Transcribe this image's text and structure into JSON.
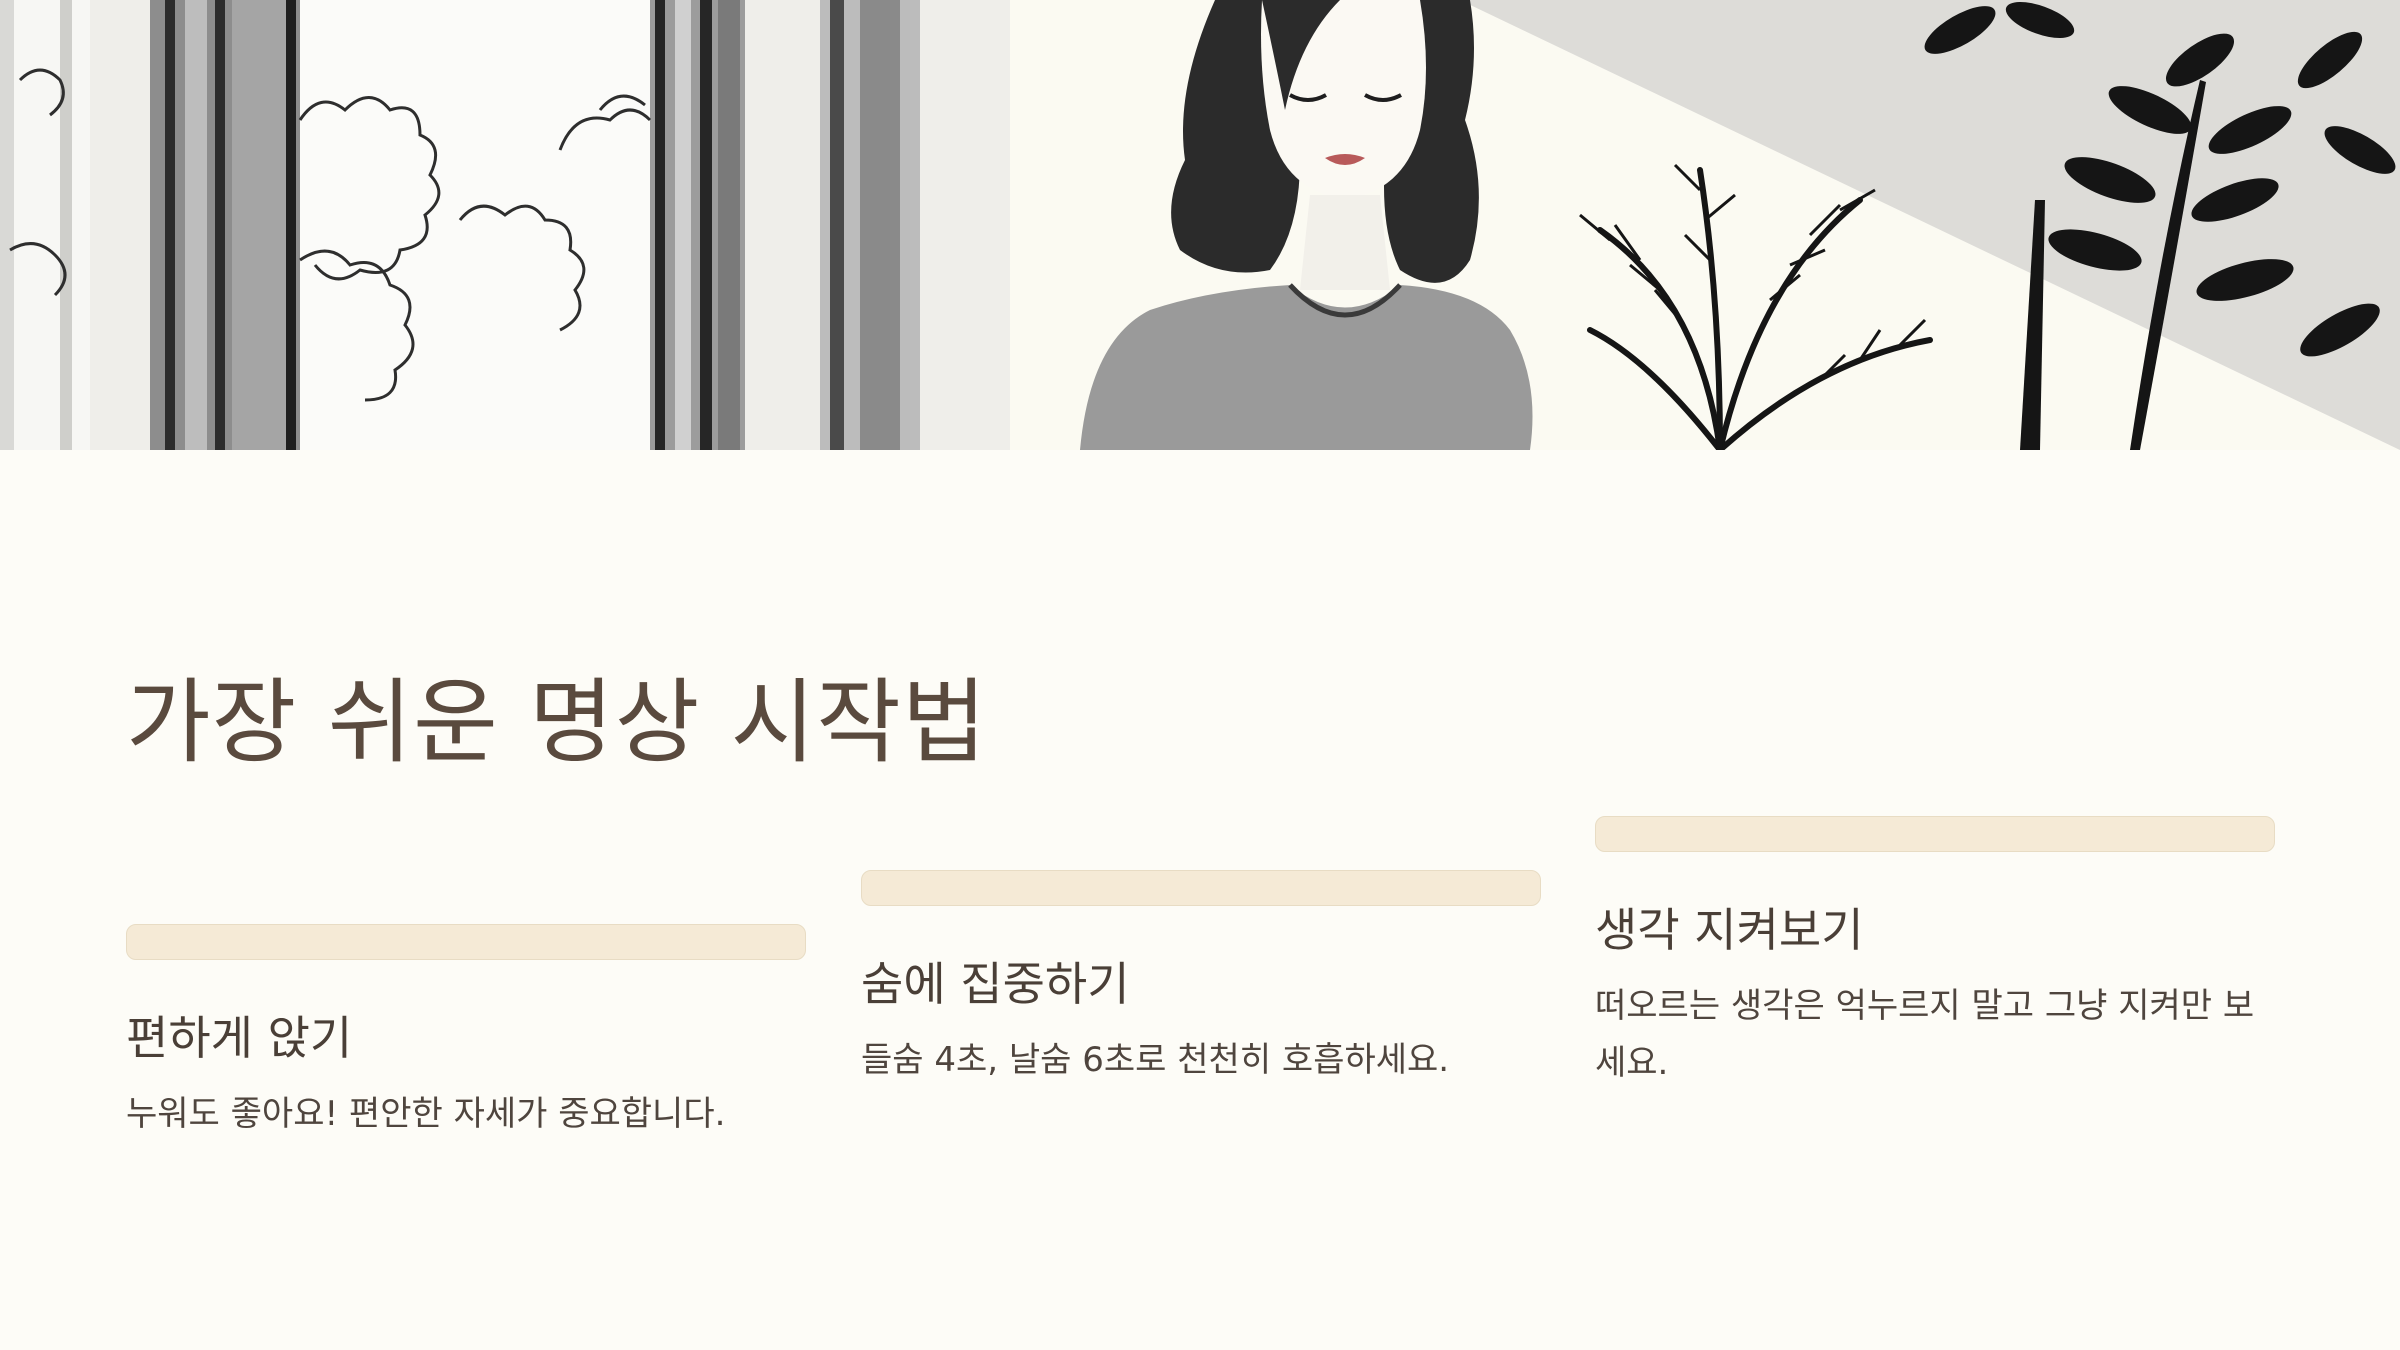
{
  "hero": {
    "image_description_icon": "meditation-illustration"
  },
  "title": "가장 쉬운 명상 시작법",
  "cards": [
    {
      "title": "편하게 앉기",
      "text": "누워도 좋아요! 편안한 자세가 중요합니다."
    },
    {
      "title": "숨에 집중하기",
      "text": "들숨 4초, 날숨 6초로 천천히 호흡하세요."
    },
    {
      "title": "생각 지켜보기",
      "text": "떠오르는 생각은 억누르지 말고 그냥 지켜만 보세요."
    }
  ],
  "colors": {
    "background": "#fdfcf7",
    "title": "#5a4a3e",
    "card_bar": "#f5ead6"
  }
}
